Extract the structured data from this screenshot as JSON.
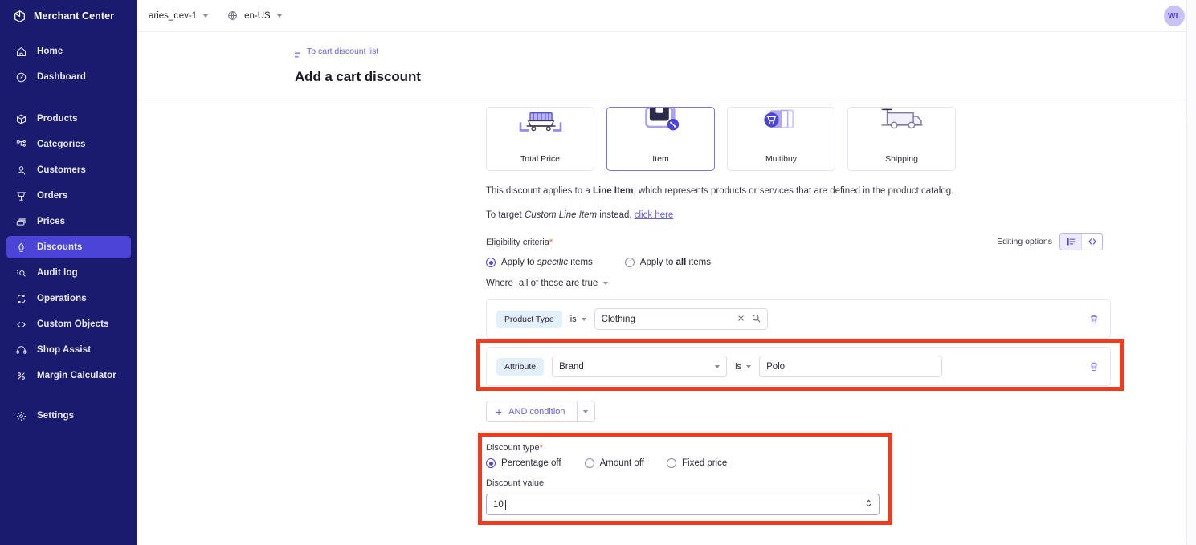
{
  "sidebar": {
    "brand": "Merchant Center",
    "brand_logo_icon": "cube-icon",
    "items": [
      {
        "label": "Home",
        "icon": "home-icon",
        "active": false,
        "gap_after": "lg"
      },
      {
        "label": "Dashboard",
        "icon": "speedometer-icon",
        "active": false,
        "gap_after": "lg"
      },
      {
        "label": "Products",
        "icon": "box-icon",
        "active": false,
        "gap_after": "none"
      },
      {
        "label": "Categories",
        "icon": "hierarchy-icon",
        "active": false,
        "gap_after": "none"
      },
      {
        "label": "Customers",
        "icon": "user-icon",
        "active": false,
        "gap_after": "none"
      },
      {
        "label": "Orders",
        "icon": "cart-icon",
        "active": false,
        "gap_after": "none"
      },
      {
        "label": "Prices",
        "icon": "tag-stack-icon",
        "active": false,
        "gap_after": "none"
      },
      {
        "label": "Discounts",
        "icon": "discount-tag-icon",
        "active": true,
        "gap_after": "none"
      },
      {
        "label": "Audit log",
        "icon": "audit-search-icon",
        "active": false,
        "gap_after": "none"
      },
      {
        "label": "Operations",
        "icon": "refresh-icon",
        "active": false,
        "gap_after": "none"
      },
      {
        "label": "Custom Objects",
        "icon": "code-brackets-icon",
        "active": false,
        "gap_after": "none"
      },
      {
        "label": "Shop Assist",
        "icon": "headset-icon",
        "active": false,
        "gap_after": "none"
      },
      {
        "label": "Margin Calculator",
        "icon": "percent-icon",
        "active": false,
        "gap_after": "sm"
      },
      {
        "label": "Settings",
        "icon": "gear-icon",
        "active": false,
        "gap_after": "none"
      }
    ]
  },
  "topbar": {
    "project": "aries_dev-1",
    "locale": "en-US",
    "locale_icon": "globe-icon",
    "avatar_initials": "WL"
  },
  "page": {
    "breadcrumb": "To cart discount list",
    "breadcrumb_icon": "back-list-icon",
    "title": "Add a cart discount"
  },
  "discount_targets": {
    "cards": [
      {
        "label": "Total Price",
        "icon": "cart-brackets-illustration",
        "selected": false
      },
      {
        "label": "Item",
        "icon": "tagged-item-percent-illustration",
        "selected": true
      },
      {
        "label": "Multibuy",
        "icon": "stacked-carts-illustration",
        "selected": false
      },
      {
        "label": "Shipping",
        "icon": "delivery-truck-illustration",
        "selected": false
      }
    ]
  },
  "description": {
    "line1_a": "This discount applies to a ",
    "line1_b": "Line Item",
    "line1_c": ", which represents products or services that are defined in the product catalog.",
    "line2_a": "To target ",
    "line2_b": "Custom Line Item",
    "line2_c": " instead, ",
    "line2_link": "click here"
  },
  "eligibility": {
    "label": "Eligibility criteria",
    "required_mark": "*",
    "editing_options_label": "Editing options",
    "editing_options": [
      {
        "name": "form-view",
        "icon": "form-list-icon",
        "active": true
      },
      {
        "name": "code-view",
        "icon": "code-brackets-icon",
        "active": false
      }
    ],
    "radios": [
      {
        "label_prefix": "Apply to ",
        "label_em": "specific",
        "label_suffix": " items",
        "selected": true
      },
      {
        "label_prefix": "Apply to ",
        "label_strong": "all",
        "label_suffix": " items",
        "selected": false
      }
    ],
    "where_prefix": "Where",
    "where_value": "all of these are true"
  },
  "conditions": [
    {
      "chip": "Product Type",
      "operator": "is",
      "value": "Clothing",
      "value_icons": [
        "clear-icon",
        "search-icon"
      ],
      "delete_icon": "trash-icon",
      "has_attribute_select": false,
      "highlighted": false
    },
    {
      "chip": "Attribute",
      "attribute_value": "Brand",
      "operator": "is",
      "value": "Polo",
      "delete_icon": "trash-icon",
      "has_attribute_select": true,
      "highlighted": true
    }
  ],
  "and_condition": {
    "label": "AND condition",
    "plus_icon": "plus-icon",
    "dropdown_icon": "chevron-down-icon"
  },
  "discount_type": {
    "label": "Discount type",
    "required_mark": "*",
    "options": [
      {
        "label": "Percentage off",
        "selected": true
      },
      {
        "label": "Amount off",
        "selected": false
      },
      {
        "label": "Fixed price",
        "selected": false
      }
    ],
    "value_label": "Discount value",
    "value": "10",
    "stepper_icon": "number-stepper-icon"
  },
  "annotations": {
    "boxes": [
      {
        "name": "attribute-condition-highlight",
        "color": "#ef3b1e"
      },
      {
        "name": "discount-type-highlight",
        "color": "#ef3b1e"
      }
    ]
  },
  "scrollbar": {
    "name": "vertical-scrollbar"
  }
}
